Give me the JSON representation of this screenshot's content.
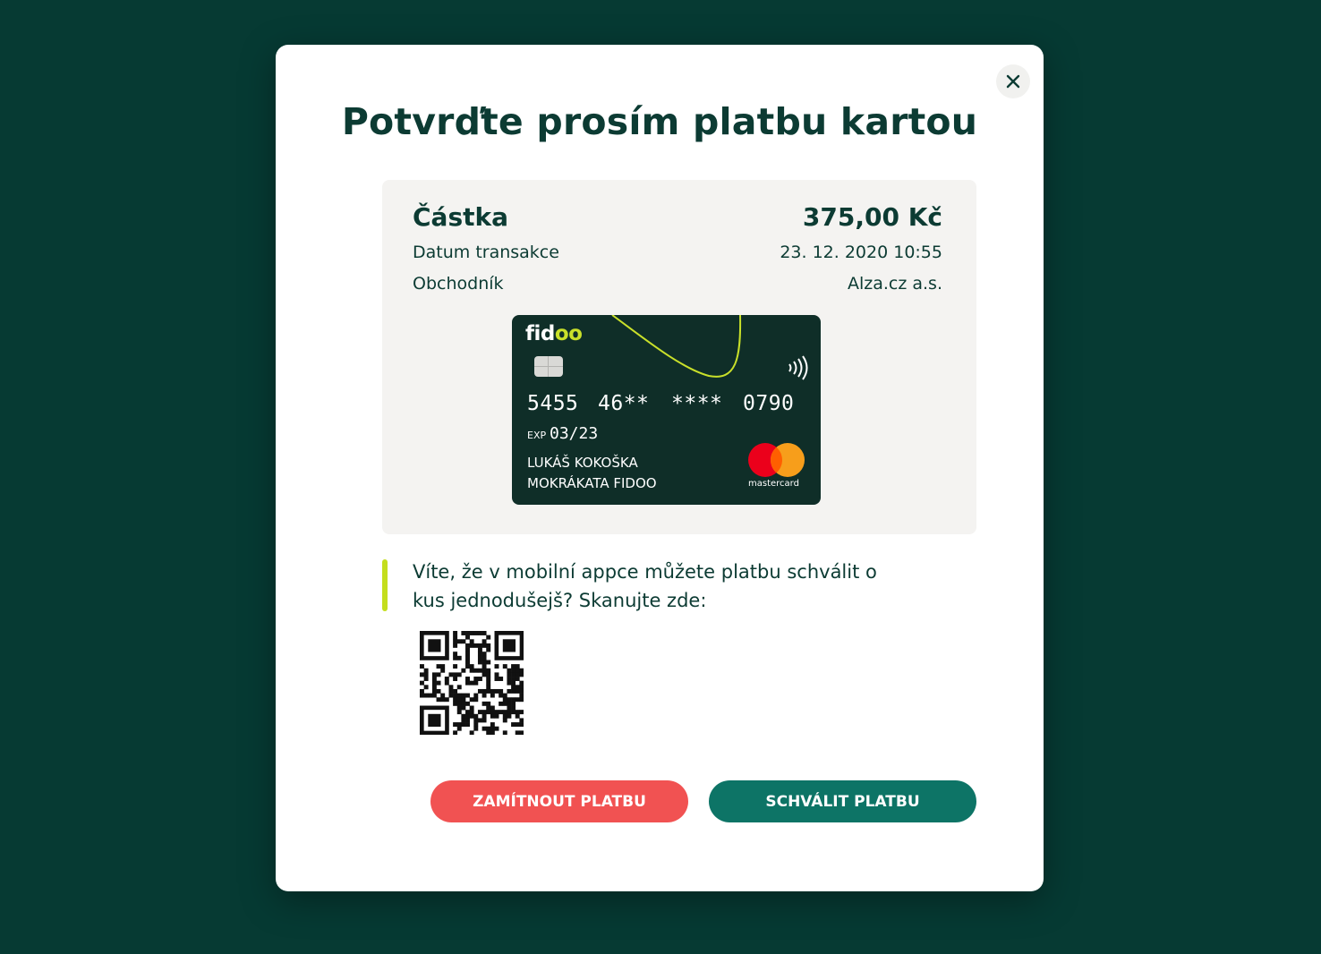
{
  "modal": {
    "title": "Potvrďte prosím platbu kartou",
    "close_icon": "close-icon"
  },
  "transaction": {
    "amount_label": "Částka",
    "amount_value": "375,00 Kč",
    "date_label": "Datum transakce",
    "date_value": "23. 12. 2020 10:55",
    "merchant_label": "Obchodník",
    "merchant_value": "Alza.cz a.s."
  },
  "card": {
    "brand_prefix": "fid",
    "brand_highlight": "oo",
    "number_groups": [
      "5455",
      "46**",
      "****",
      "0790"
    ],
    "exp_label": "EXP",
    "exp_value": "03/23",
    "holder_line1": "LUKÁŠ KOKOŠKA",
    "holder_line2": "MOKRÁKATA FIDOO",
    "network": "mastercard",
    "colors": {
      "background": "#0f2e28",
      "accent": "#c9e02a"
    },
    "icons": [
      "chip-icon",
      "contactless-icon",
      "mastercard-logo"
    ]
  },
  "hint": {
    "text": "Víte, že v mobilní appce můžete platbu schválit o kus jednodušejš? Skanujte zde:"
  },
  "actions": {
    "reject_label": "ZAMÍTNOUT PLATBU",
    "approve_label": "SCHVÁLIT PLATBU"
  },
  "colors": {
    "backdrop": "#063a33",
    "text_primary": "#0c3b33",
    "reject": "#f15252",
    "approve": "#0d7466",
    "hint_accent": "#c4de1d"
  }
}
